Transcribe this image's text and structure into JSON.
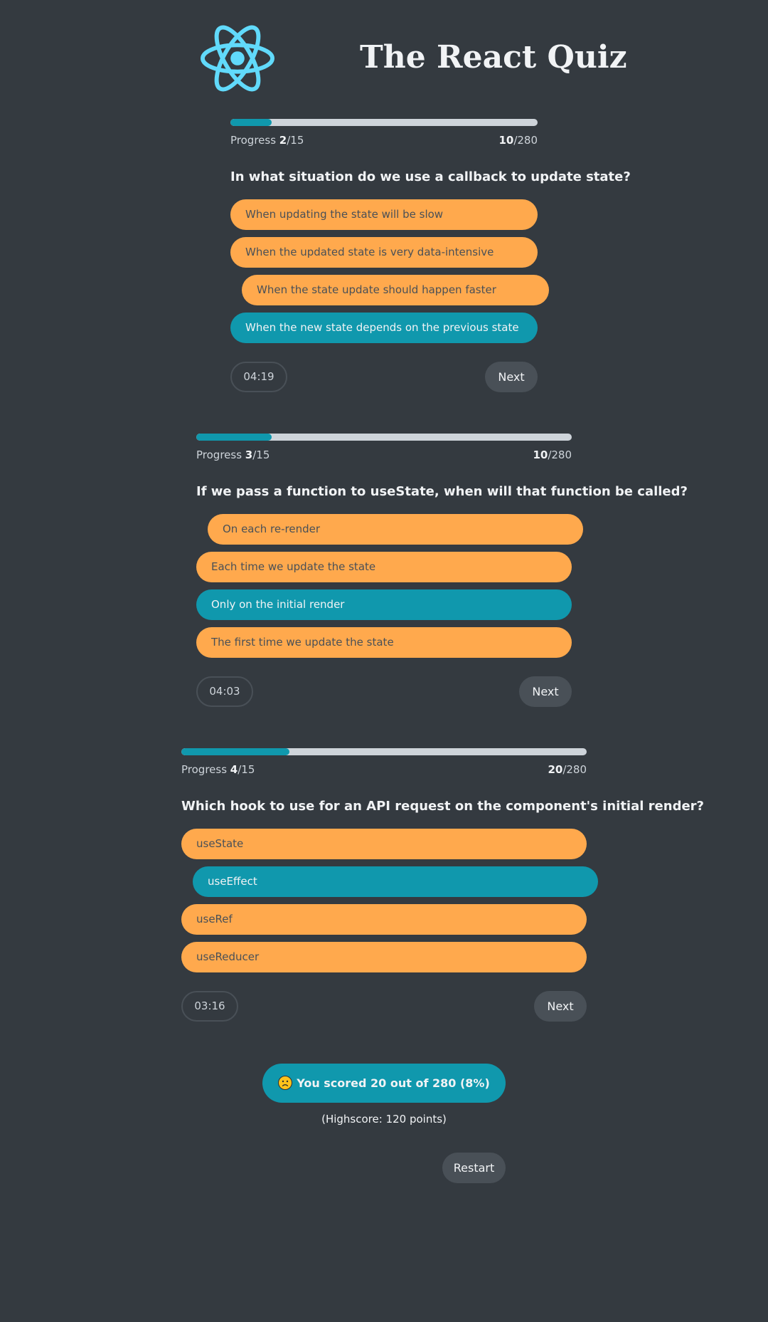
{
  "app": {
    "title": "The React Quiz",
    "logo_icon": "react-atom-icon",
    "accent_color": "#61dafb"
  },
  "quizzes": [
    {
      "progress_label": "Progress",
      "current": "2",
      "total": "/15",
      "progress_fraction": 0.1333,
      "points": "10",
      "max_points": "/280",
      "question": "In what situation do we use a callback to update state?",
      "options": [
        "When updating the state will be slow",
        "When the updated state is very data-intensive",
        "When the state update should happen faster",
        "When the new state depends on the previous state"
      ],
      "selected_index": 2,
      "correct_index": 3,
      "timer": "04:19",
      "next_label": "Next"
    },
    {
      "progress_label": "Progress",
      "current": "3",
      "total": "/15",
      "progress_fraction": 0.2,
      "points": "10",
      "max_points": "/280",
      "question": "If we pass a function to useState, when will that function be called?",
      "options": [
        "On each re-render",
        "Each time we update the state",
        "Only on the initial render",
        "The first time we update the state"
      ],
      "selected_index": 0,
      "correct_index": 2,
      "timer": "04:03",
      "next_label": "Next"
    },
    {
      "progress_label": "Progress",
      "current": "4",
      "total": "/15",
      "progress_fraction": 0.2667,
      "points": "20",
      "max_points": "/280",
      "question": "Which hook to use for an API request on the component's initial render?",
      "options": [
        "useState",
        "useEffect",
        "useRef",
        "useReducer"
      ],
      "selected_index": 1,
      "correct_index": 1,
      "timer": "03:16",
      "next_label": "Next"
    }
  ],
  "result": {
    "emoji": "frowning-face-icon",
    "prefix": "You scored",
    "points": "20",
    "suffix": "out of 280 (8%)"
  },
  "highscore": "(Highscore: 120 points)",
  "restart_label": "Restart",
  "colors": {
    "background": "#343a40",
    "theme": "#1098ad",
    "accent": "#ffa94d",
    "medium": "#495057",
    "light": "#ced4da"
  }
}
